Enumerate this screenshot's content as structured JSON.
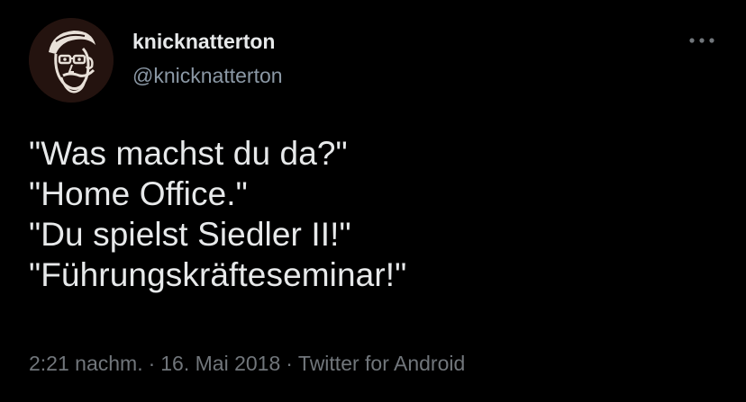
{
  "user": {
    "display_name": "knicknatterton",
    "handle": "@knicknatterton",
    "avatar_icon": "cartoon-face-avatar"
  },
  "menu": {
    "icon": "more-horizontal-icon"
  },
  "tweet": {
    "lines": [
      "\"Was machst du da?\"",
      "\"Home Office.\"",
      "\"Du spielst Siedler II!\"",
      "\"Führungskräfteseminar!\""
    ]
  },
  "meta": {
    "time": "2:21 nachm.",
    "separator": "·",
    "date": "16. Mai 2018",
    "source": "Twitter for Android"
  },
  "colors": {
    "background": "#000000",
    "primary_text": "#e7e9ea",
    "secondary_text": "#71767b"
  }
}
